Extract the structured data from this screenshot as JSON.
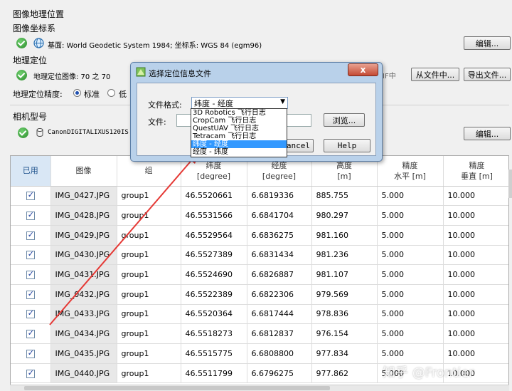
{
  "panel": {
    "group_title": "图像地理位置",
    "coord_system_title": "图像坐标系",
    "datum_text": "基面: World Geodetic System 1984; 坐标系: WGS 84 (egm96)",
    "edit_label": "编辑...",
    "geolocation_title": "地理定位",
    "geolocation_text": "地理定位图像: 70 之 70",
    "from_suffix_label": "IF中",
    "from_file_label": "从文件中...",
    "export_file_label": "导出文件...",
    "accuracy_label": "地理定位精度:",
    "accuracy_standard": "标准",
    "accuracy_low_partial": "低",
    "camera_title": "相机型号",
    "camera_text": "CanonDIGITALIXUS120IS",
    "camera_edit_label": "编辑..."
  },
  "dialog": {
    "title": "选择定位信息文件",
    "close_glyph": "x",
    "format_label": "文件格式:",
    "format_value": "纬度 - 经度",
    "file_label": "文件:",
    "file_value": "",
    "browse_label": "浏览...",
    "cancel_partial": "ancel",
    "help_label": "Help",
    "options": [
      "3D Robotics 飞行日志",
      "CropCam 飞行日志",
      "QuestUAV 飞行日志",
      "Tetracam 飞行日志",
      "纬度 - 经度",
      "经度 - 纬度"
    ],
    "selected_option_index": 4
  },
  "table": {
    "headers": {
      "enabled": "已用",
      "image": "图像",
      "group": "组",
      "lat": "纬度",
      "lat_unit": "[degree]",
      "lon": "经度",
      "lon_unit": "[degree]",
      "alt": "高度",
      "alt_unit": "[m]",
      "acc_h": "精度",
      "acc_h_sub": "水平 [m]",
      "acc_v": "精度",
      "acc_v_sub": "垂直 [m]"
    },
    "rows": [
      {
        "image": "IMG_0427.JPG",
        "group": "group1",
        "lat": "46.5520661",
        "lon": "6.6819336",
        "alt": "885.755",
        "acc_h": "5.000",
        "acc_v": "10.000"
      },
      {
        "image": "IMG_0428.JPG",
        "group": "group1",
        "lat": "46.5531566",
        "lon": "6.6841704",
        "alt": "980.297",
        "acc_h": "5.000",
        "acc_v": "10.000"
      },
      {
        "image": "IMG_0429.JPG",
        "group": "group1",
        "lat": "46.5529564",
        "lon": "6.6836275",
        "alt": "981.160",
        "acc_h": "5.000",
        "acc_v": "10.000"
      },
      {
        "image": "IMG_0430.JPG",
        "group": "group1",
        "lat": "46.5527389",
        "lon": "6.6831434",
        "alt": "981.236",
        "acc_h": "5.000",
        "acc_v": "10.000"
      },
      {
        "image": "IMG_0431.JPG",
        "group": "group1",
        "lat": "46.5524690",
        "lon": "6.6826887",
        "alt": "981.107",
        "acc_h": "5.000",
        "acc_v": "10.000"
      },
      {
        "image": "IMG_0432.JPG",
        "group": "group1",
        "lat": "46.5522389",
        "lon": "6.6822306",
        "alt": "979.569",
        "acc_h": "5.000",
        "acc_v": "10.000"
      },
      {
        "image": "IMG_0433.JPG",
        "group": "group1",
        "lat": "46.5520364",
        "lon": "6.6817444",
        "alt": "978.836",
        "acc_h": "5.000",
        "acc_v": "10.000"
      },
      {
        "image": "IMG_0434.JPG",
        "group": "group1",
        "lat": "46.5518273",
        "lon": "6.6812837",
        "alt": "976.154",
        "acc_h": "5.000",
        "acc_v": "10.000"
      },
      {
        "image": "IMG_0435.JPG",
        "group": "group1",
        "lat": "46.5515775",
        "lon": "6.6808800",
        "alt": "977.834",
        "acc_h": "5.000",
        "acc_v": "10.000"
      },
      {
        "image": "IMG_0440.JPG",
        "group": "group1",
        "lat": "46.5511799",
        "lon": "6.6796275",
        "alt": "977.862",
        "acc_h": "5.000",
        "acc_v": "10.000"
      }
    ]
  },
  "watermark": "知乎 @Frontier",
  "colors": {
    "arrow": "#e53935",
    "selection": "#3399ff",
    "ok": "#2a8a2a"
  }
}
